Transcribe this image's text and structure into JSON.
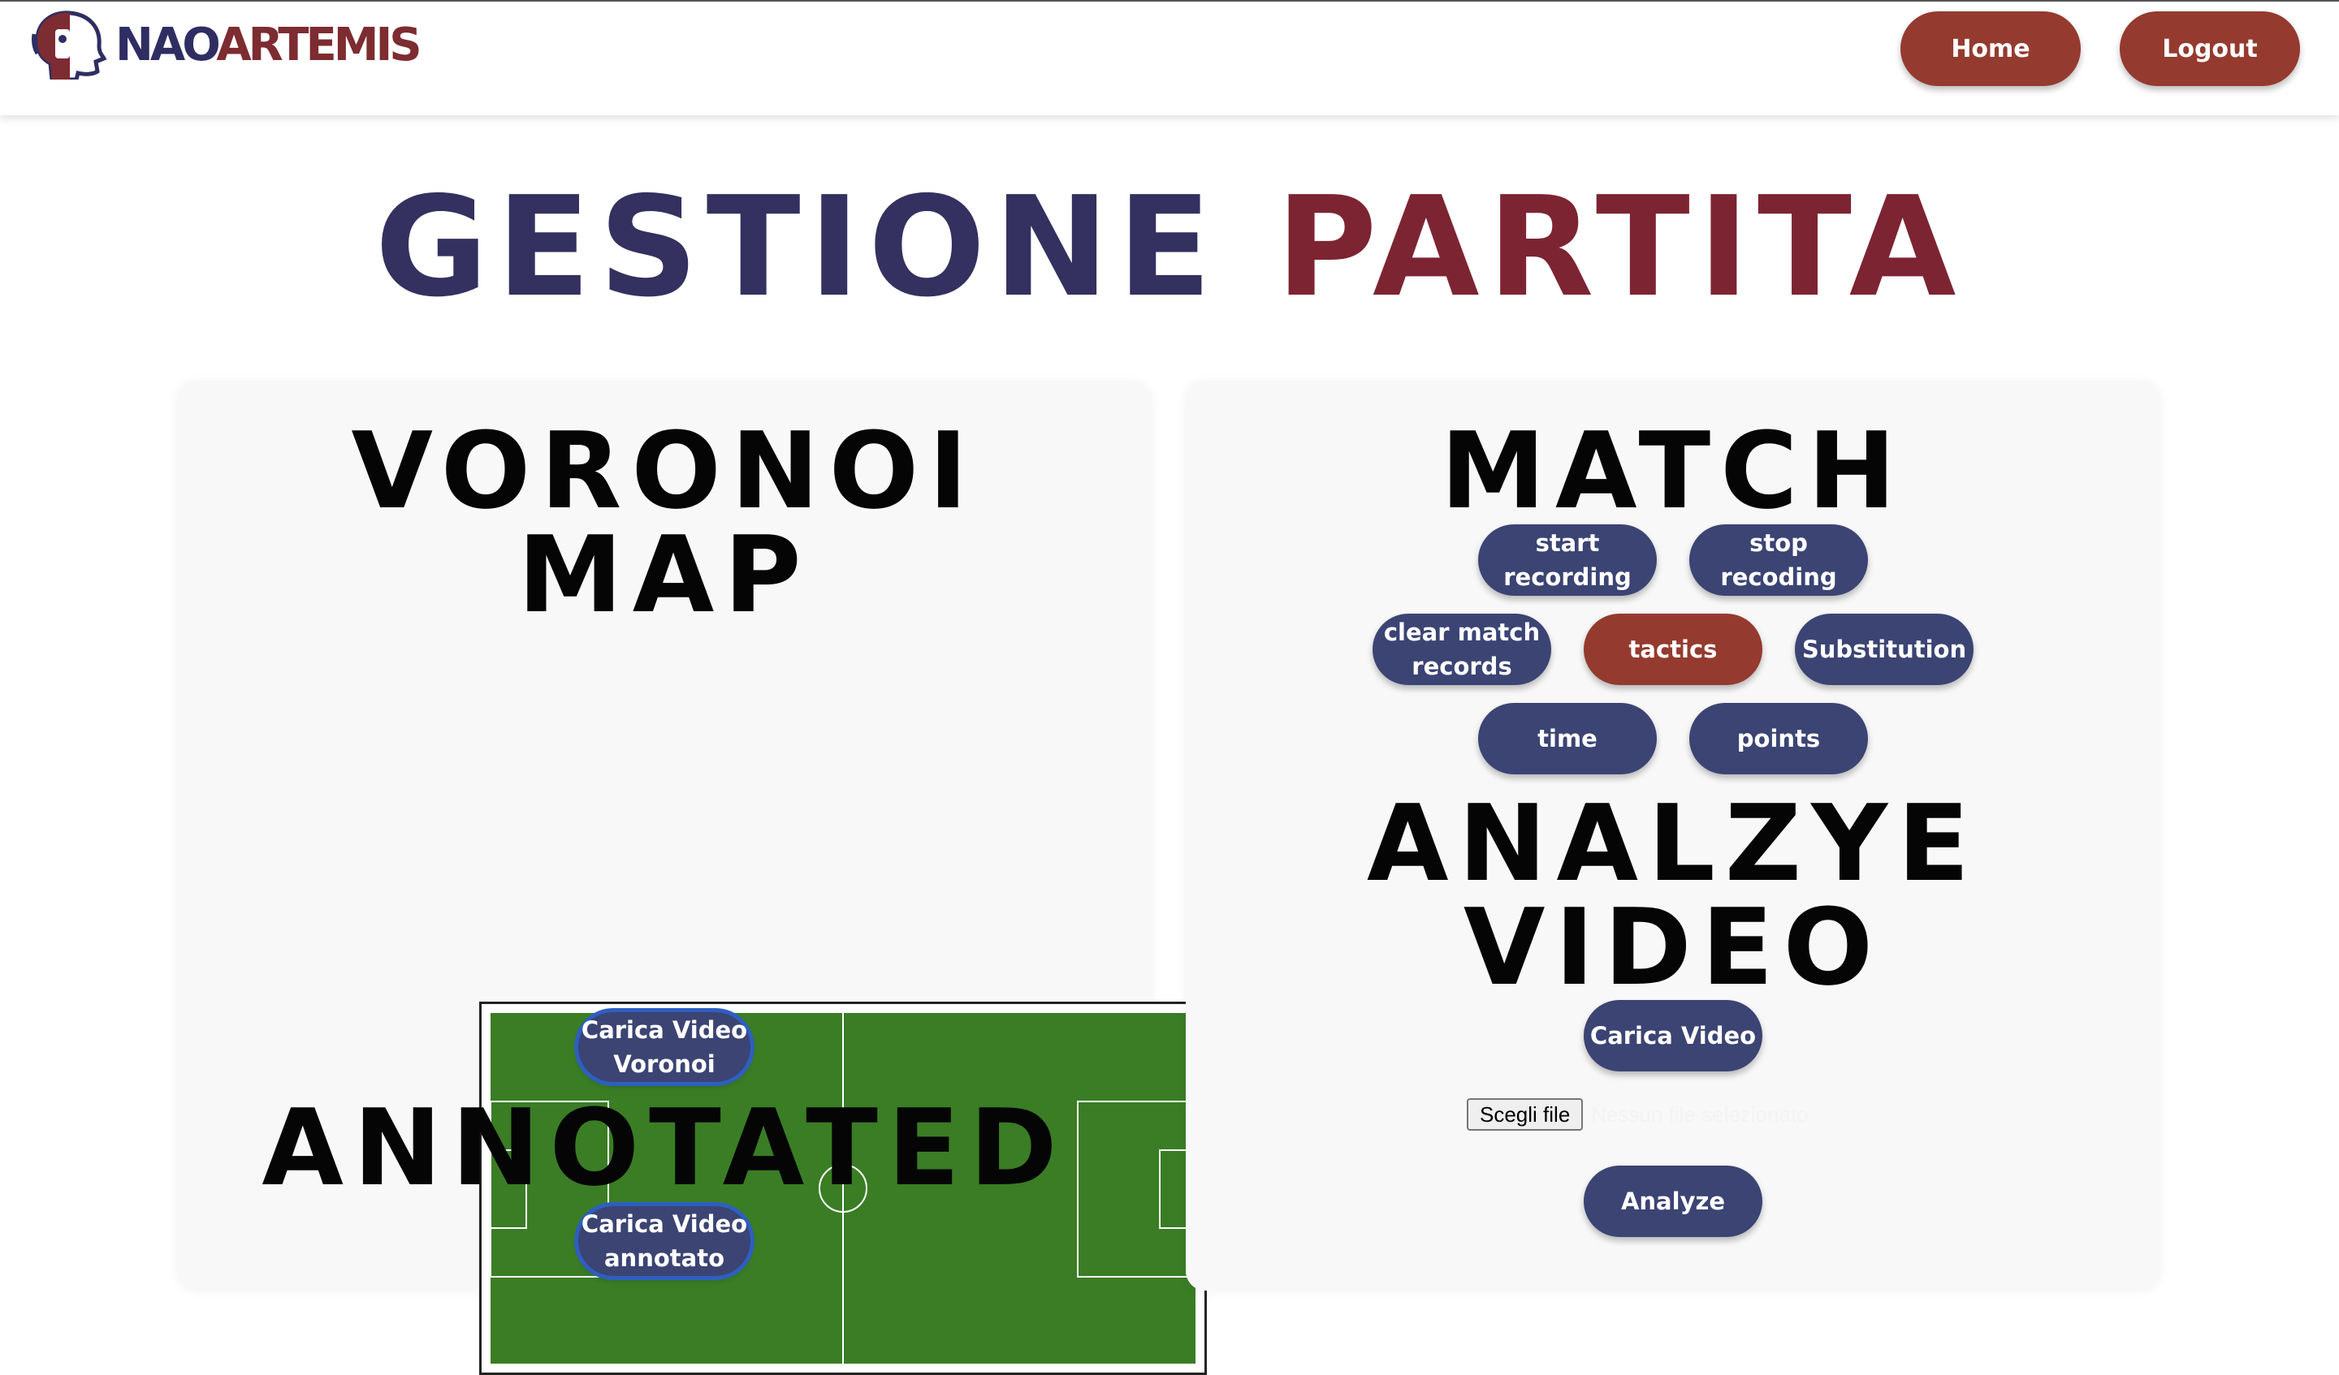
{
  "header": {
    "logo_text_a": "NAO",
    "logo_text_b": "ARTEMIS",
    "home_label": "Home",
    "logout_label": "Logout"
  },
  "page": {
    "title_word1": "GESTIONE",
    "title_word2": "PARTITA"
  },
  "voronoi": {
    "title_line1": "VORONOI",
    "title_line2": "MAP",
    "upload_label_line1": "Carica Video",
    "upload_label_line2": "Voronoi",
    "annotated_title": "ANNOTATED",
    "annotated_upload_line1": "Carica Video",
    "annotated_upload_line2": "annotato"
  },
  "match": {
    "title": "MATCH",
    "start_line1": "start",
    "start_line2": "recording",
    "stop_line1": "stop",
    "stop_line2": "recoding",
    "clear_line1": "clear match",
    "clear_line2": "records",
    "tactics": "tactics",
    "substitution": "Substitution",
    "time": "time",
    "points": "points"
  },
  "analyze": {
    "title_line1": "ANALZYE",
    "title_line2": "VIDEO",
    "upload_label": "Carica Video",
    "file_button": "Scegli file",
    "file_status": "Nessun file selezionato",
    "analyze_label": "Analyze"
  },
  "colors": {
    "navy": "#3b4473",
    "brick": "#953a2f",
    "pitch": "#3a7d25"
  },
  "icons": {
    "logo": "robot-head-logo-icon"
  }
}
